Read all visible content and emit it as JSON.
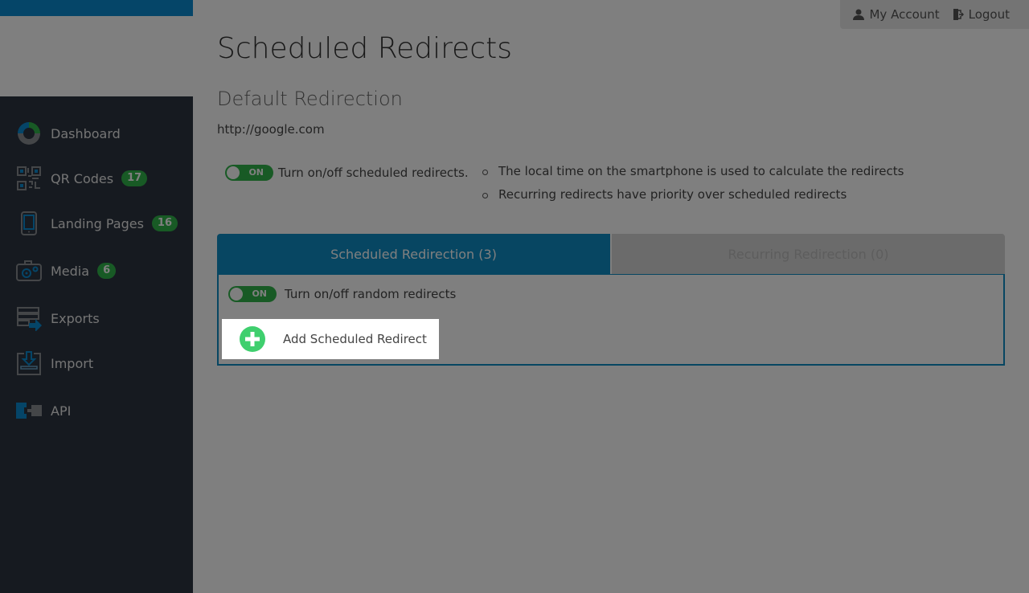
{
  "sidebar": {
    "items": [
      {
        "label": "Dashboard",
        "icon": "dashboard-donut-icon",
        "badge": null
      },
      {
        "label": "QR Codes",
        "icon": "qr-code-icon",
        "badge": "17"
      },
      {
        "label": "Landing Pages",
        "icon": "smartphone-icon",
        "badge": "16"
      },
      {
        "label": "Media",
        "icon": "camera-icon",
        "badge": "6"
      },
      {
        "label": "Exports",
        "icon": "export-icon",
        "badge": null
      },
      {
        "label": "Import",
        "icon": "import-icon",
        "badge": null
      },
      {
        "label": "API",
        "icon": "api-plug-icon",
        "badge": null
      }
    ]
  },
  "header": {
    "my_account": "My Account",
    "logout": "Logout"
  },
  "page": {
    "title": "Scheduled Redirects",
    "default_section_title": "Default Redirection",
    "default_url": "http://google.com",
    "scheduled_toggle": {
      "state": "ON",
      "label": "Turn on/off scheduled redirects."
    },
    "notes": [
      "The local time on the smartphone is used to calculate the redirects",
      "Recurring redirects have priority over scheduled redirects"
    ],
    "tabs": [
      {
        "label": "Scheduled Redirection (3)",
        "active": true
      },
      {
        "label": "Recurring Redirection (0)",
        "active": false
      }
    ],
    "random_toggle": {
      "state": "ON",
      "label": "Turn on/off random redirects"
    },
    "add_button": "Add Scheduled Redirect"
  },
  "colors": {
    "brand_blue": "#0e8cc4",
    "success_green": "#31b44b",
    "add_green": "#3fcf6e",
    "sidebar_bg": "#2d3540"
  }
}
